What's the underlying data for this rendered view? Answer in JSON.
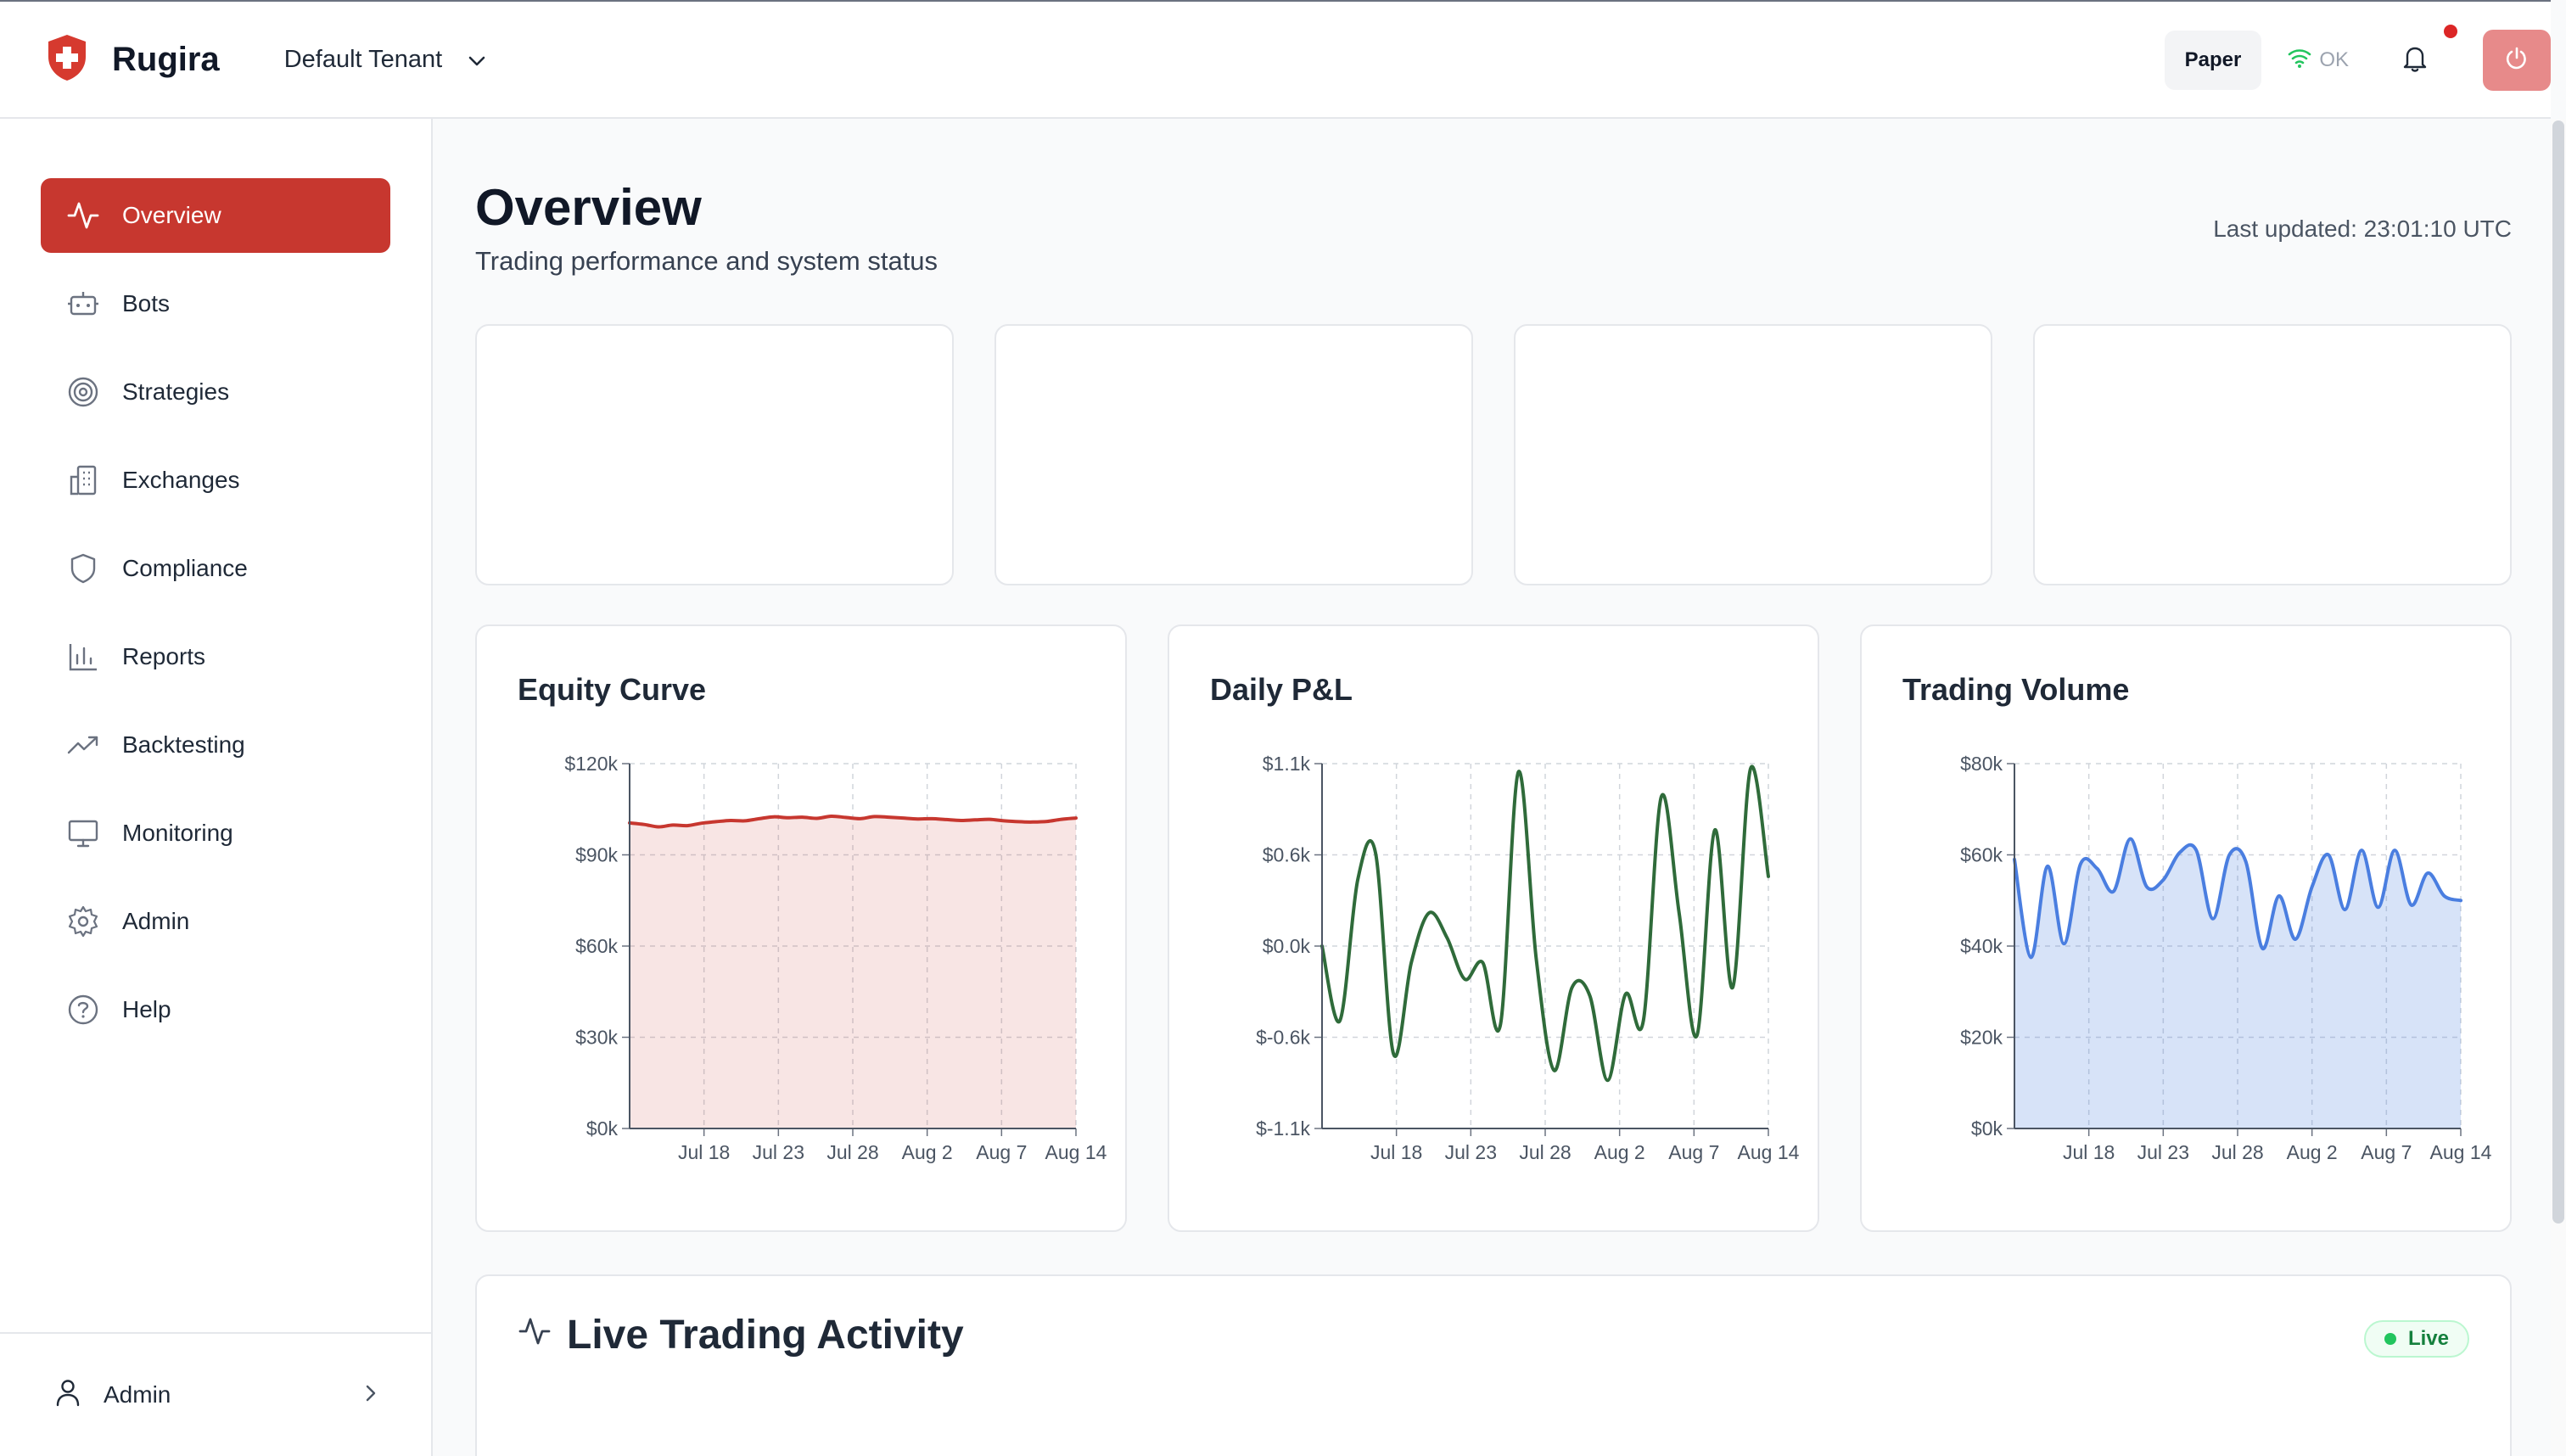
{
  "app": {
    "name": "Rugira",
    "tenant": "Default Tenant"
  },
  "topbar": {
    "mode_label": "Paper",
    "status_label": "OK"
  },
  "sidebar": {
    "items": [
      {
        "label": "Overview",
        "icon": "activity-icon",
        "active": true
      },
      {
        "label": "Bots",
        "icon": "bot-icon"
      },
      {
        "label": "Strategies",
        "icon": "target-icon"
      },
      {
        "label": "Exchanges",
        "icon": "building-icon"
      },
      {
        "label": "Compliance",
        "icon": "shield-icon"
      },
      {
        "label": "Reports",
        "icon": "bar-chart-icon"
      },
      {
        "label": "Backtesting",
        "icon": "trending-up-icon"
      },
      {
        "label": "Monitoring",
        "icon": "monitor-icon"
      },
      {
        "label": "Admin",
        "icon": "gear-icon"
      },
      {
        "label": "Help",
        "icon": "help-circle-icon"
      }
    ],
    "footer_user": "Admin"
  },
  "page": {
    "title": "Overview",
    "subtitle": "Trading performance and system status",
    "last_updated": "Last updated: 23:01:10 UTC"
  },
  "activity": {
    "title": "Live Trading Activity",
    "badge": "Live"
  },
  "colors": {
    "accent": "#c7372f",
    "equity": "#c7372f",
    "pnl": "#2f6b3a",
    "volume": "#4a7ee0"
  },
  "chart_data": [
    {
      "type": "area",
      "title": "Equity Curve",
      "x_ticks": [
        "Jul 18",
        "Jul 23",
        "Jul 28",
        "Aug 2",
        "Aug 7",
        "Aug 14"
      ],
      "y_ticks": [
        "$0k",
        "$30k",
        "$60k",
        "$90k",
        "$120k"
      ],
      "ylim": [
        0,
        120000
      ],
      "values": [
        100500,
        100000,
        99200,
        99800,
        99600,
        100400,
        100900,
        101300,
        101200,
        101900,
        102500,
        102200,
        102400,
        102000,
        102700,
        102300,
        101900,
        102600,
        102400,
        102100,
        101800,
        101900,
        101600,
        101300,
        101500,
        101700,
        101200,
        100900,
        100800,
        101000,
        101700,
        102100
      ],
      "grid": true
    },
    {
      "type": "line",
      "title": "Daily P&L",
      "x_ticks": [
        "Jul 18",
        "Jul 23",
        "Jul 28",
        "Aug 2",
        "Aug 7",
        "Aug 14"
      ],
      "y_ticks": [
        "$-1.1k",
        "$-0.6k",
        "$0.0k",
        "$0.6k",
        "$1.1k"
      ],
      "ylim": [
        -1100,
        1100
      ],
      "values": [
        0,
        -450,
        400,
        560,
        -650,
        -100,
        200,
        50,
        -200,
        -100,
        -470,
        1050,
        -80,
        -750,
        -250,
        -300,
        -810,
        -290,
        -450,
        900,
        200,
        -540,
        700,
        -250,
        1070,
        420
      ],
      "grid": true
    },
    {
      "type": "area",
      "title": "Trading Volume",
      "x_ticks": [
        "Jul 18",
        "Jul 23",
        "Jul 28",
        "Aug 2",
        "Aug 7",
        "Aug 14"
      ],
      "y_ticks": [
        "$0k",
        "$20k",
        "$40k",
        "$60k",
        "$80k"
      ],
      "ylim": [
        0,
        80000
      ],
      "values": [
        59000,
        37500,
        57500,
        40500,
        58000,
        57000,
        52000,
        63500,
        53000,
        54500,
        60500,
        61000,
        46000,
        60000,
        58500,
        39500,
        51000,
        41500,
        53000,
        60000,
        48000,
        61000,
        48500,
        61000,
        49000,
        56000,
        51000,
        50000
      ],
      "grid": true
    }
  ]
}
